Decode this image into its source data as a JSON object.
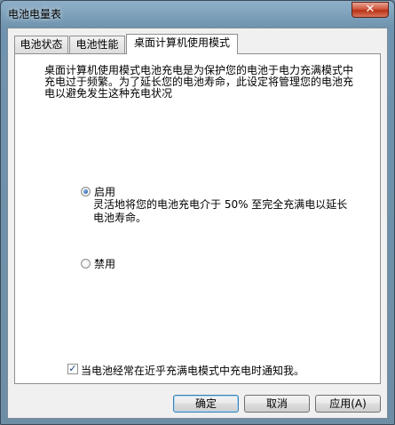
{
  "window": {
    "title": "电池电量表",
    "close_glyph": "✕"
  },
  "tabs": [
    {
      "label": "电池状态"
    },
    {
      "label": "电池性能"
    },
    {
      "label": "桌面计算机使用模式"
    }
  ],
  "panel": {
    "description": "桌面计算机使用模式电池充电是为保护您的电池于电力充满模式中充电过于频繁。为了延长您的电池寿命，此设定将管理您的电池充电以避免发生这种充电状况",
    "options": {
      "enable": {
        "label": "启用",
        "checked": true,
        "sub_text": "灵活地将您的电池充电介于 50% 至完全充满电以延长电池寿命。"
      },
      "disable": {
        "label": "禁用",
        "checked": false
      }
    },
    "notify": {
      "label": "当电池经常在近乎充满电模式中充电时通知我。",
      "checked": true,
      "check_glyph": "✓"
    }
  },
  "buttons": {
    "ok": "确定",
    "cancel": "取消",
    "apply": "应用(A)"
  }
}
